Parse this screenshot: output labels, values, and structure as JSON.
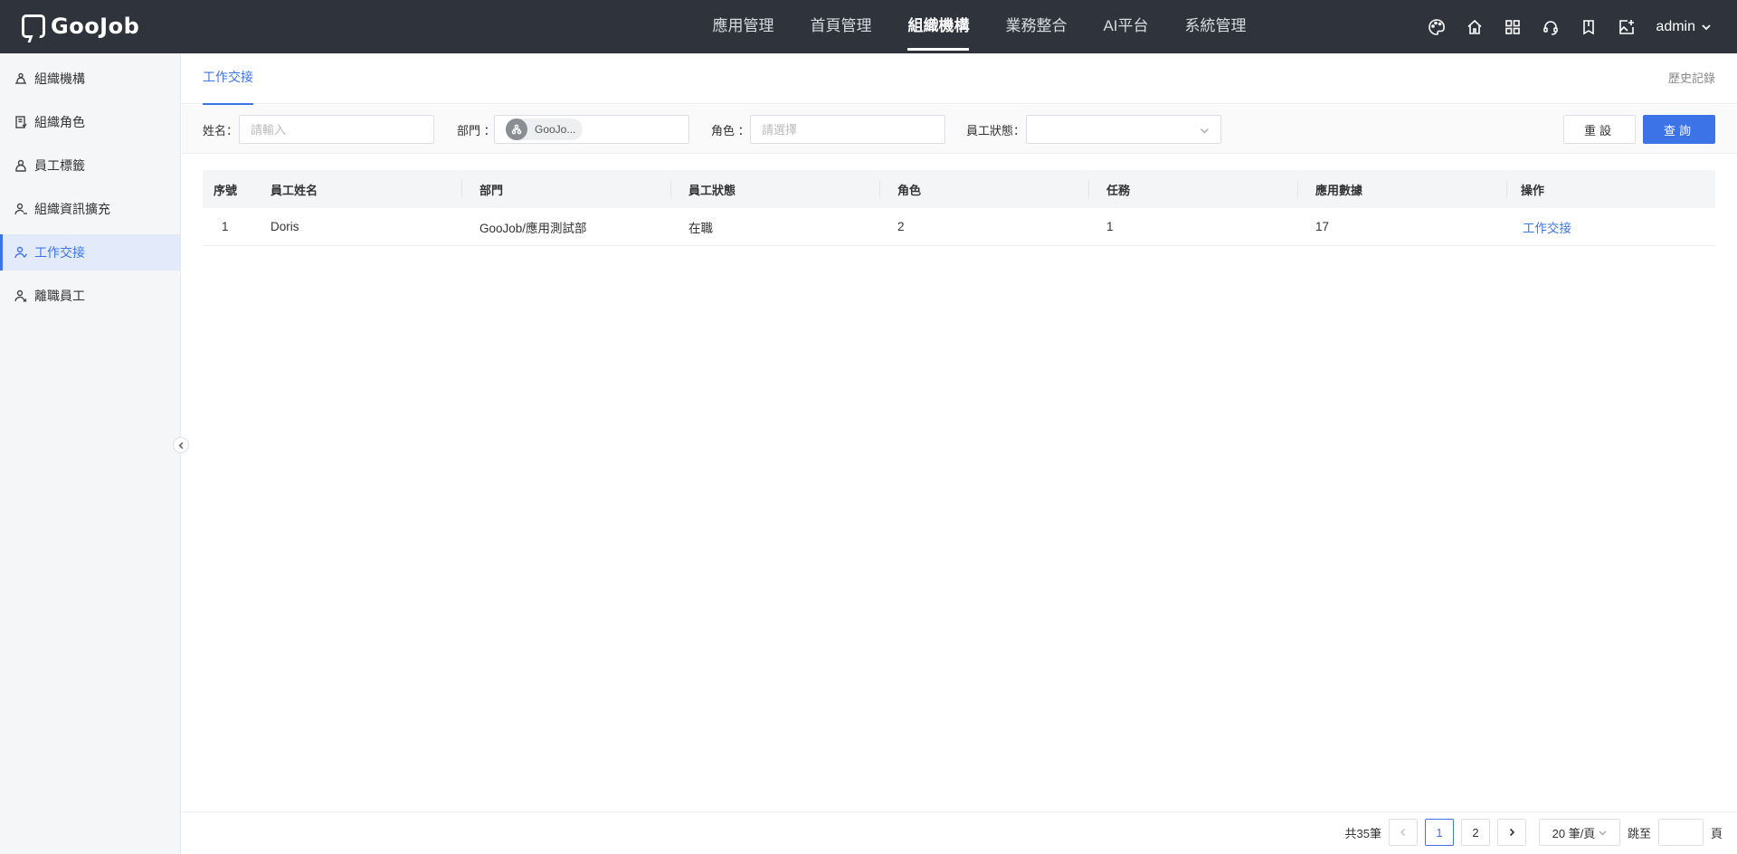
{
  "brand": {
    "name": "GooJob"
  },
  "nav": {
    "items": [
      {
        "label": "應用管理",
        "active": false
      },
      {
        "label": "首頁管理",
        "active": false
      },
      {
        "label": "組織機構",
        "active": true
      },
      {
        "label": "業務整合",
        "active": false
      },
      {
        "label": "AI平台",
        "active": false
      },
      {
        "label": "系統管理",
        "active": false
      }
    ]
  },
  "header": {
    "user": "admin"
  },
  "sidebar": {
    "items": [
      {
        "label": "組織機構",
        "icon": "org-icon"
      },
      {
        "label": "組織角色",
        "icon": "role-icon"
      },
      {
        "label": "員工標籤",
        "icon": "tag-icon"
      },
      {
        "label": "組織資訊擴充",
        "icon": "user-extend-icon"
      },
      {
        "label": "工作交接",
        "icon": "handover-icon",
        "active": true
      },
      {
        "label": "離職員工",
        "icon": "resigned-icon"
      }
    ]
  },
  "tabs": {
    "active": "工作交接",
    "history": "歷史記錄"
  },
  "filter": {
    "name_label": "姓名：",
    "name_placeholder": "請輸入",
    "dept_label": "部門 ：",
    "dept_value": "GooJo...",
    "role_label": "角色 ：",
    "role_placeholder": "請選擇",
    "status_label": "員工狀態：",
    "reset": "重設",
    "query": "查詢"
  },
  "table": {
    "headers": [
      "序號",
      "員工姓名",
      "部門",
      "員工狀態",
      "角色",
      "任務",
      "應用數據",
      "操作"
    ],
    "rows": [
      {
        "index": "1",
        "name": "Doris",
        "dept": "GooJob/應用測試部",
        "status": "在職",
        "role": "2",
        "task": "1",
        "data": "17",
        "action": "工作交接"
      }
    ]
  },
  "pagination": {
    "total": "共35筆",
    "pages": [
      "1",
      "2"
    ],
    "current": "1",
    "page_size": "20 筆/頁",
    "jump_label": "跳至",
    "page_suffix": "頁"
  },
  "colors": {
    "accent": "#3c74e8",
    "topbar": "#2f333b"
  }
}
